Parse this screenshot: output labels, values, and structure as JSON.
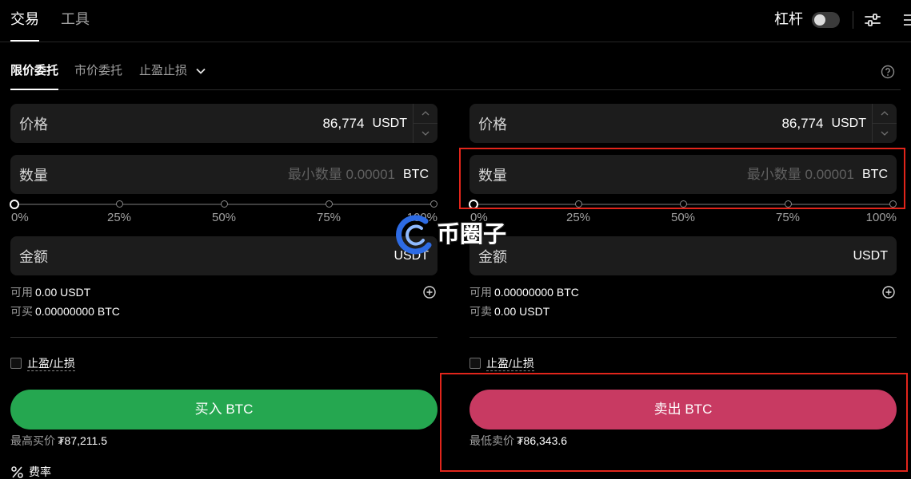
{
  "top_nav": {
    "tabs": [
      {
        "label": "交易"
      },
      {
        "label": "工具"
      }
    ],
    "active_index": 0,
    "leverage_label": "杠杆",
    "leverage_enabled": false
  },
  "order_tabs": {
    "items": [
      {
        "label": "限价委托"
      },
      {
        "label": "市价委托"
      },
      {
        "label": "止盈止损",
        "has_dropdown": true
      }
    ],
    "active_index": 0
  },
  "buy": {
    "price": {
      "label": "价格",
      "value": "86,774",
      "unit": "USDT"
    },
    "quantity": {
      "label": "数量",
      "placeholder": "最小数量 0.00001",
      "unit": "BTC"
    },
    "slider": {
      "value_percent": 0,
      "marks": [
        "0%",
        "25%",
        "50%",
        "75%",
        "100%"
      ]
    },
    "amount": {
      "label": "金额",
      "unit": "USDT"
    },
    "available": {
      "label": "可用",
      "value": "0.00 USDT"
    },
    "max": {
      "label": "可买",
      "value": "0.00000000 BTC"
    },
    "tpsl": {
      "label": "止盈/止损",
      "checked": false
    },
    "submit_label": "买入 BTC",
    "best_price": {
      "label": "最高买价",
      "value": "₮87,211.5"
    }
  },
  "sell": {
    "price": {
      "label": "价格",
      "value": "86,774",
      "unit": "USDT"
    },
    "quantity": {
      "label": "数量",
      "placeholder": "最小数量 0.00001",
      "unit": "BTC"
    },
    "slider": {
      "value_percent": 0,
      "marks": [
        "0%",
        "25%",
        "50%",
        "75%",
        "100%"
      ]
    },
    "amount": {
      "label": "金额",
      "unit": "USDT"
    },
    "available": {
      "label": "可用",
      "value": "0.00000000 BTC"
    },
    "max": {
      "label": "可卖",
      "value": "0.00 USDT"
    },
    "tpsl": {
      "label": "止盈/止损",
      "checked": false
    },
    "submit_label": "卖出 BTC",
    "best_price": {
      "label": "最低卖价",
      "value": "₮86,343.6"
    }
  },
  "fee": {
    "label": "费率"
  },
  "watermark": {
    "text": "币圈子"
  },
  "icons": {
    "settings": "sliders-icon",
    "layout": "menu-icon",
    "order_type_dropdown": "chevron-down-icon",
    "help": "question-circle-icon",
    "stepper_up": "chevron-up-icon",
    "stepper_down": "chevron-down-icon",
    "transfer": "plus-circle-icon",
    "fee": "percent-icon",
    "watermark_logo": "logo-icon"
  },
  "colors": {
    "background": "#000000",
    "field": "#1c1c1c",
    "buy": "#25a750",
    "sell": "#c83a62",
    "highlight": "#e1251b",
    "muted": "#9b9b9b"
  }
}
